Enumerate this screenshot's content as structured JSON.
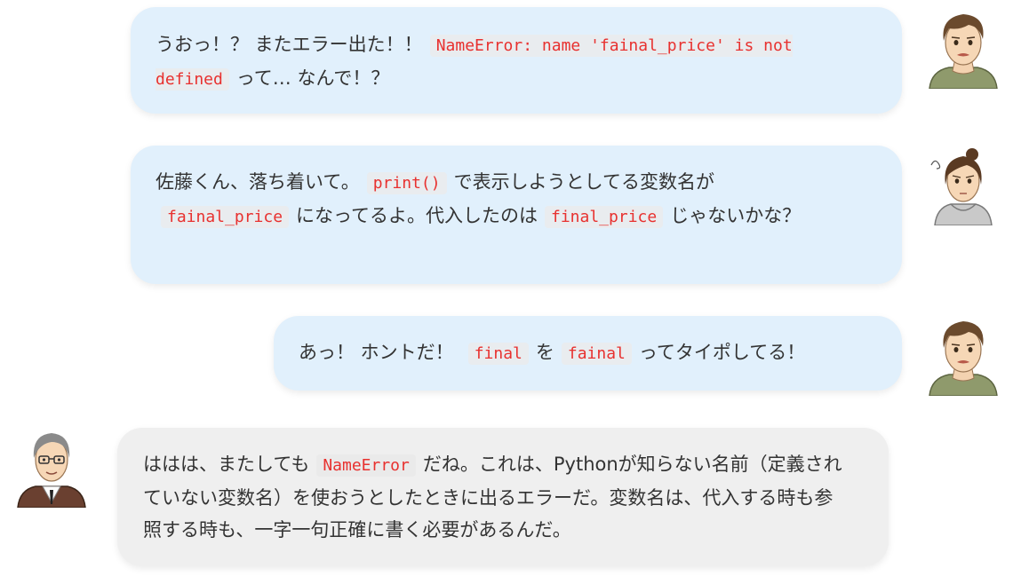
{
  "messages": [
    {
      "speaker": "student",
      "before": "うおっ！？ またエラー出た！！",
      "code1": "NameError: name 'fainal_price' is not defined",
      "after": "って… なんで！？"
    },
    {
      "speaker": "classmate",
      "part1": "佐藤くん、落ち着いて。",
      "code1": "print()",
      "part2": "で表示しようとしてる変数名が",
      "code2": "fainal_price",
      "part3": "になってるよ。代入したのは",
      "code3": "final_price",
      "part4": "じゃないかな？"
    },
    {
      "speaker": "student",
      "part1": "あっ！ ホントだ！",
      "code1": "final",
      "part2": "を",
      "code2": "fainal",
      "part3": "ってタイポしてる！"
    },
    {
      "speaker": "teacher",
      "part1": "ははは、またしても",
      "code1": "NameError",
      "part2": "だね。これは、Pythonが知らない名前（定義されていない変数名）を使おうとしたときに出るエラーだ。変数名は、代入する時も参照する時も、一字一句正確に書く必要があるんだ。"
    }
  ],
  "colors": {
    "bubble_blue": "#e1f0fc",
    "bubble_gray": "#efefef",
    "code_red": "#e8312f"
  }
}
